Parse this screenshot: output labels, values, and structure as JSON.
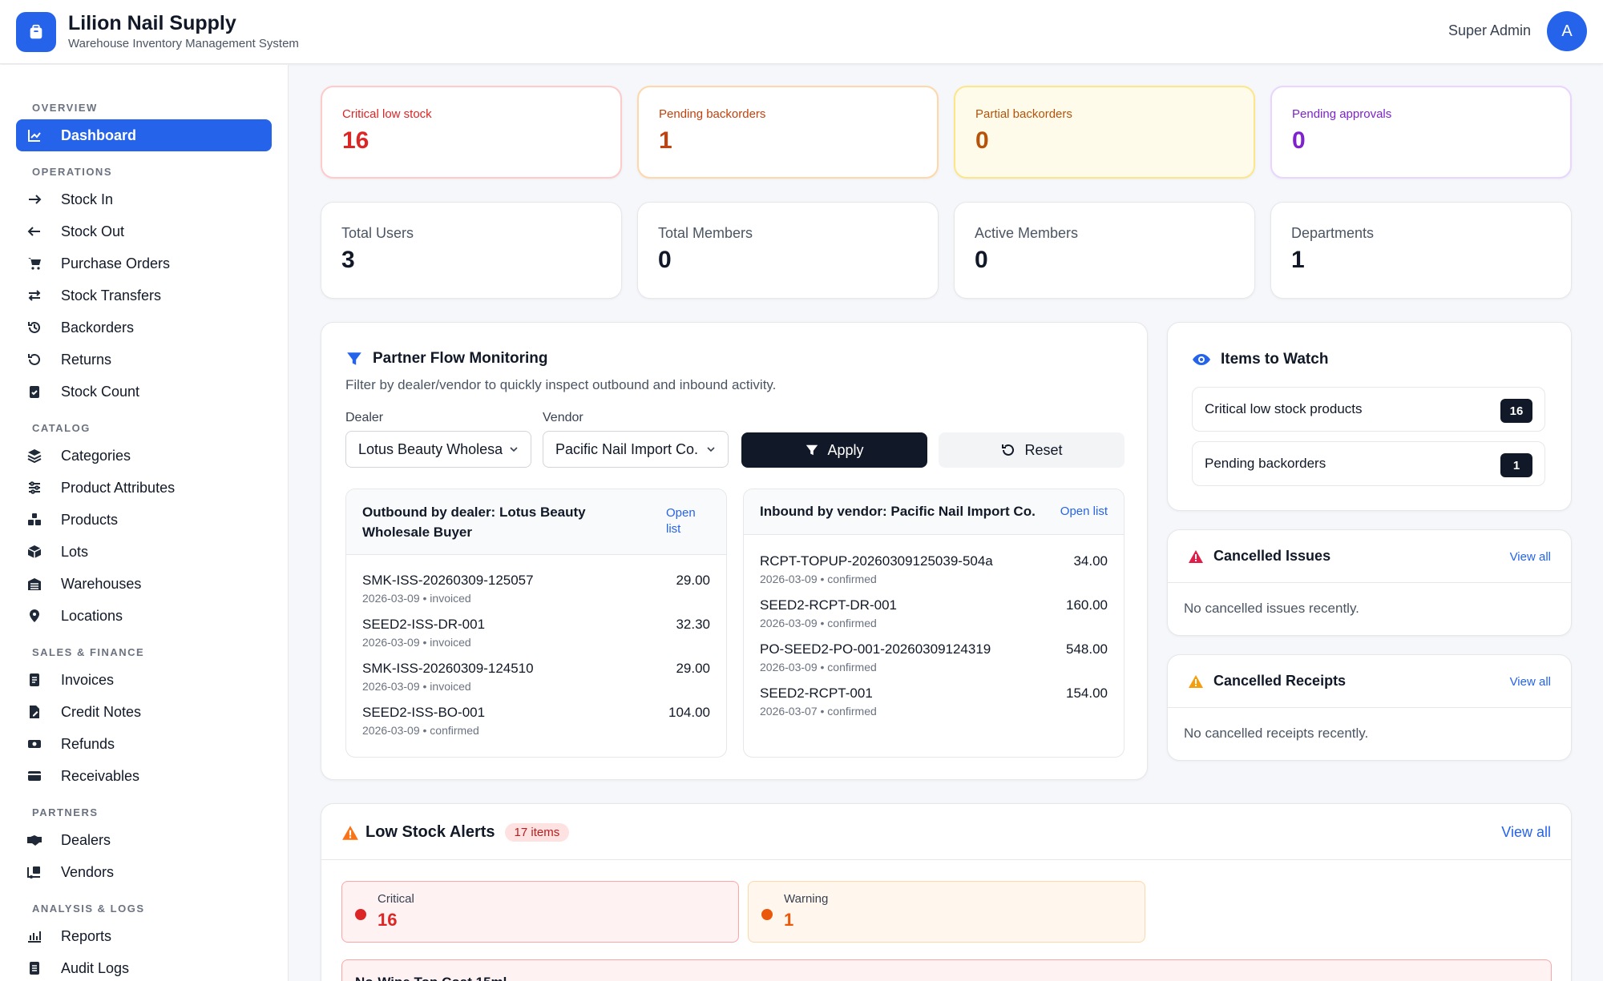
{
  "app": {
    "title": "Lilion Nail Supply",
    "subtitle": "Warehouse Inventory Management System",
    "user_name": "Super Admin",
    "avatar_initial": "A",
    "accent": "#2563eb"
  },
  "sidebar": {
    "sections": {
      "overview": "OVERVIEW",
      "operations": "OPERATIONS",
      "catalog": "CATALOG",
      "sales": "SALES & FINANCE",
      "partners": "PARTNERS",
      "analysis": "ANALYSIS & LOGS"
    },
    "items": {
      "dashboard": "Dashboard",
      "stock_in": "Stock In",
      "stock_out": "Stock Out",
      "purchase_orders": "Purchase Orders",
      "stock_transfers": "Stock Transfers",
      "backorders": "Backorders",
      "returns": "Returns",
      "stock_count": "Stock Count",
      "categories": "Categories",
      "product_attributes": "Product Attributes",
      "products": "Products",
      "lots": "Lots",
      "warehouses": "Warehouses",
      "locations": "Locations",
      "invoices": "Invoices",
      "credit_notes": "Credit Notes",
      "refunds": "Refunds",
      "receivables": "Receivables",
      "dealers": "Dealers",
      "vendors": "Vendors",
      "reports": "Reports",
      "audit_logs": "Audit Logs"
    }
  },
  "alerts_row": [
    {
      "label": "Critical low stock",
      "value": "16",
      "color": "#dc2626"
    },
    {
      "label": "Pending backorders",
      "value": "1",
      "color": "#c2410c"
    },
    {
      "label": "Partial backorders",
      "value": "0",
      "color": "#b45309"
    },
    {
      "label": "Pending approvals",
      "value": "0",
      "color": "#7e22ce"
    }
  ],
  "stats_row": [
    {
      "label": "Total Users",
      "value": "3"
    },
    {
      "label": "Total Members",
      "value": "0"
    },
    {
      "label": "Active Members",
      "value": "0"
    },
    {
      "label": "Departments",
      "value": "1"
    }
  ],
  "partner_flow": {
    "title": "Partner Flow Monitoring",
    "description": "Filter by dealer/vendor to quickly inspect outbound and inbound activity.",
    "dealer_label": "Dealer",
    "dealer_value": "Lotus Beauty Wholesa",
    "vendor_label": "Vendor",
    "vendor_value": "Pacific Nail Import Co.",
    "apply_label": "Apply",
    "reset_label": "Reset",
    "outbound": {
      "title": "Outbound by dealer: Lotus Beauty Wholesale Buyer",
      "link": "Open list",
      "rows": [
        {
          "id": "SMK-ISS-20260309-125057",
          "meta": "2026-03-09 • invoiced",
          "amount": "29.00"
        },
        {
          "id": "SEED2-ISS-DR-001",
          "meta": "2026-03-09 • invoiced",
          "amount": "32.30"
        },
        {
          "id": "SMK-ISS-20260309-124510",
          "meta": "2026-03-09 • invoiced",
          "amount": "29.00"
        },
        {
          "id": "SEED2-ISS-BO-001",
          "meta": "2026-03-09 • confirmed",
          "amount": "104.00"
        }
      ]
    },
    "inbound": {
      "title": "Inbound by vendor: Pacific Nail Import Co.",
      "link": "Open list",
      "rows": [
        {
          "id": "RCPT-TOPUP-20260309125039-504a",
          "meta": "2026-03-09 • confirmed",
          "amount": "34.00"
        },
        {
          "id": "SEED2-RCPT-DR-001",
          "meta": "2026-03-09 • confirmed",
          "amount": "160.00"
        },
        {
          "id": "PO-SEED2-PO-001-20260309124319",
          "meta": "2026-03-09 • confirmed",
          "amount": "548.00"
        },
        {
          "id": "SEED2-RCPT-001",
          "meta": "2026-03-07 • confirmed",
          "amount": "154.00"
        }
      ]
    }
  },
  "watch": {
    "title": "Items to Watch",
    "items": [
      {
        "label": "Critical low stock products",
        "count": "16"
      },
      {
        "label": "Pending backorders",
        "count": "1"
      }
    ]
  },
  "cancelled_issues": {
    "title": "Cancelled Issues",
    "link": "View all",
    "empty": "No cancelled issues recently."
  },
  "cancelled_receipts": {
    "title": "Cancelled Receipts",
    "link": "View all",
    "empty": "No cancelled receipts recently."
  },
  "low_stock": {
    "title": "Low Stock Alerts",
    "badge": "17 items",
    "link": "View all",
    "critical_label": "Critical",
    "critical_value": "16",
    "warning_label": "Warning",
    "warning_value": "1",
    "first_item": "No-Wipe Top Coat 15ml"
  }
}
